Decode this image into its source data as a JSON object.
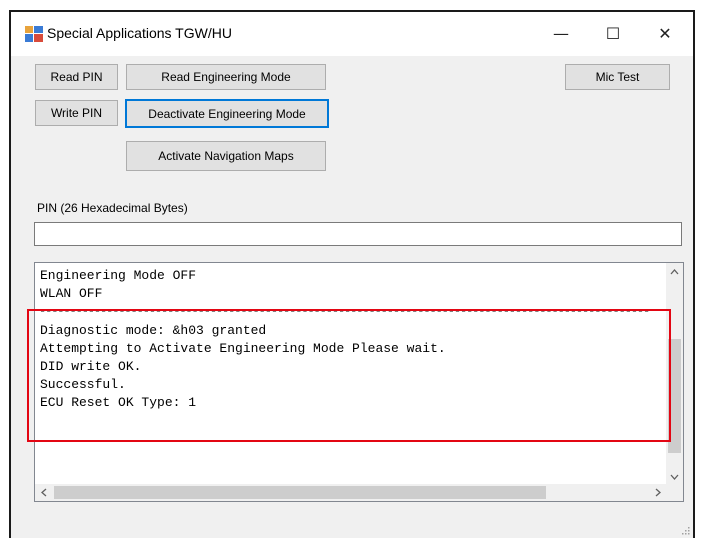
{
  "window": {
    "title": "Special Applications TGW/HU"
  },
  "titlebar_buttons": {
    "minimize": "—",
    "maximize": "☐",
    "close": "✕"
  },
  "buttons": {
    "read_pin": "Read PIN",
    "read_engineering_mode": "Read Engineering Mode",
    "mic_test": "Mic Test",
    "write_pin": "Write PIN",
    "deactivate_engineering_mode": "Deactivate Engineering Mode",
    "activate_navigation_maps": "Activate Navigation Maps"
  },
  "pin_field": {
    "label": "PIN (26 Hexadecimal Bytes)",
    "value": ""
  },
  "output": {
    "lines": [
      "Engineering Mode OFF",
      "WLAN OFF",
      "----------------------------------------------------------------------------------------------------",
      "Diagnostic mode: &h03 granted",
      "Attempting to Activate Engineering Mode Please wait.",
      "DID write OK.",
      "Successful.",
      "ECU Reset OK Type: 1"
    ]
  },
  "scrollbar_icons": {
    "up": "chevron-up-icon",
    "down": "chevron-down-icon",
    "left": "chevron-left-icon",
    "right": "chevron-right-icon"
  },
  "colors": {
    "highlight": "#e30613",
    "focus": "#0078d7"
  }
}
